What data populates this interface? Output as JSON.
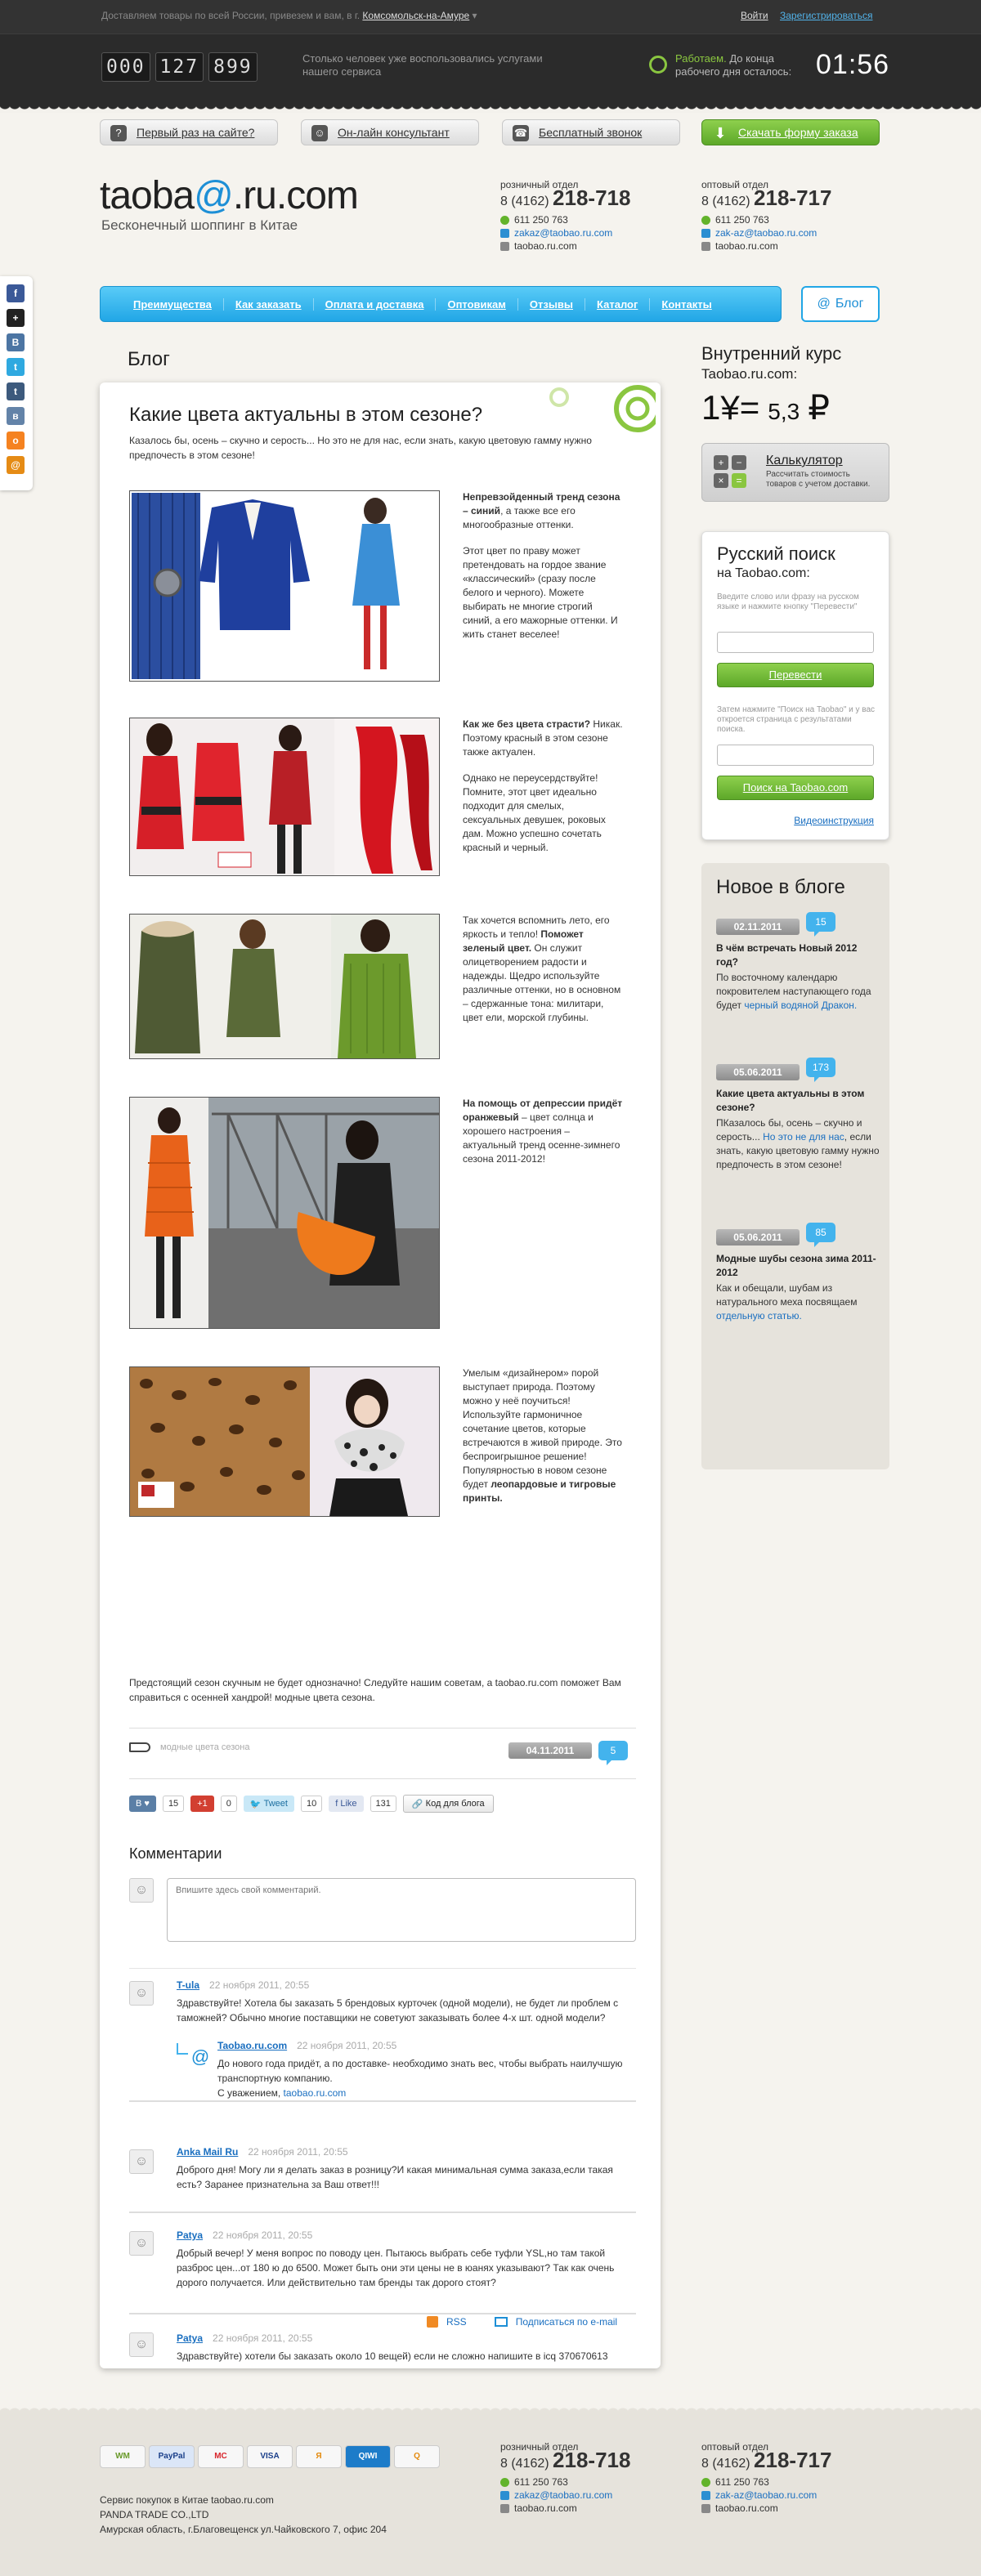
{
  "topbar": {
    "delivery_text": "Доставляем товары по всей России, привезем и вам, в г.",
    "city": "Комсомольск-на-Амуре",
    "login": "Войти",
    "register": "Зарегистрироваться",
    "counter": [
      "000",
      "127",
      "899"
    ],
    "counter_text": "Столько человек уже воспользовались услугами нашего сервиса",
    "work_status": "Работаем.",
    "work_text": "До конца рабочего дня осталось:",
    "time_left": "01:56"
  },
  "actions": {
    "first_time": "Первый раз на сайте?",
    "consultant": "Он-лайн консультант",
    "free_call": "Бесплатный звонок",
    "download": "Скачать форму заказа"
  },
  "brand": {
    "logo_pre": "taoba",
    "logo_swirl": "@",
    "logo_post": ".ru.com",
    "slogan": "Бесконечный шоппинг в Китае"
  },
  "contacts": [
    {
      "title": "розничный отдел",
      "code": "8 (4162)",
      "number": "218-718",
      "icq": "611 250 763",
      "email": "zakaz@taobao.ru.com",
      "site": "taobao.ru.com"
    },
    {
      "title": "оптовый отдел",
      "code": "8 (4162)",
      "number": "218-717",
      "icq": "611 250 763",
      "email": "zak-az@taobao.ru.com",
      "site": "taobao.ru.com"
    }
  ],
  "menu": [
    "Преимущества",
    "Как заказать",
    "Оплата и доставка",
    "Оптовикам",
    "Отзывы",
    "Каталог",
    "Контакты"
  ],
  "blog_button": "Блог",
  "section_title": "Блог",
  "article": {
    "title": "Какие цвета актуальны в этом сезоне?",
    "intro": "Казалось бы, осень – скучно и серость... Но это не для нас, если знать, какую цветовую гамму нужно предпочесть в этом сезоне!",
    "blocks": [
      {
        "p1_bold": "Непревзойденный тренд сезона – синий",
        "p1_rest": ", а также все его многообразные оттенки.",
        "p2": "Этот цвет по праву может претендовать на гордое звание «классический» (сразу после белого и черного). Можете выбирать не многие строгий синий, а его мажорные оттенки. И жить станет веселее!"
      },
      {
        "p1_bold": "Как же без цвета страсти?",
        "p1_rest": " Никак. Поэтому красный в этом сезоне также актуален.",
        "p2": "Однако не переусердствуйте! Помните, этот цвет идеально подходит для смелых, сексуальных девушек, роковых дам. Можно успешно сочетать красный и черный."
      },
      {
        "p1_pre": "Так хочется вспомнить лето, его яркость и тепло! ",
        "p1_bold": "Поможет зеленый цвет.",
        "p1_rest": " Он служит олицетворением радости и надежды. Щедро используйте различные оттенки, но в основном – сдержанные тона: милитари, цвет ели, морской глубины."
      },
      {
        "p1_bold": "На помощь от депрессии придёт оранжевый",
        "p1_rest": " – цвет солнца и хорошего настроения – актуальный тренд осенне-зимнего сезона 2011-2012!"
      },
      {
        "p1_pre": "Умелым «дизайнером» порой выступает природа. Поэтому можно у неё поучиться! Используйте гармоничное сочетание цветов, которые встречаются в живой природе. Это беспроигрышное решение! Популярностью в новом сезоне будет ",
        "p1_bold": "леопардовые и тигровые принты."
      }
    ],
    "summary": "Предстоящий сезон скучным не будет однозначно! Следуйте нашим советам, а taobao.ru.com поможет Вам справиться с осенней хандрой! модные цвета сезона.",
    "tag": "модные цвета сезона",
    "date": "04.11.2011",
    "comments_count": "5",
    "share": {
      "vk_count": "15",
      "gplus_count": "0",
      "tweet": "Tweet",
      "tweet_count": "10",
      "like": "Like",
      "like_count": "131",
      "code_button": "Код для блога"
    }
  },
  "comments": {
    "heading": "Комментарии",
    "placeholder": "Впишите здесь свой комментарий.",
    "items": [
      {
        "author": "T-ula",
        "date": "22 ноября 2011, 20:55",
        "text": "Здравствуйте! Хотела бы заказать 5 брендовых курточек (одной модели), не будет ли проблем с таможней? Обычно многие поставщики не советуют заказывать более 4-х шт. одной модели?"
      },
      {
        "author": "Taobao.ru.com",
        "date": "22 ноября 2011, 20:55",
        "text": "До нового года придёт, а по доставке- необходимо знать вес, чтобы выбрать наилучшую транспортную компанию.",
        "sign": "С уважением,",
        "sign_link": "taobao.ru.com"
      },
      {
        "author": "Anka Mail Ru",
        "date": "22 ноября 2011, 20:55",
        "text": "Доброго дня! Могу ли я делать заказ в розницу?И какая минимальная сумма заказа,если такая есть? Заранее признательна за Ваш ответ!!!"
      },
      {
        "author": "Patya",
        "date": "22 ноября 2011, 20:55",
        "text": "Добрый вечер! У меня вопрос по поводу цен. Пытаюсь выбрать себе туфли YSL,но там такой разброс цен...от 180 ю до 6500. Может быть они эти цены не в юанях указывают? Так как очень дорого получается. Или действительно там бренды так дорого стоят?"
      },
      {
        "author": "Patya",
        "date": "22 ноября 2011, 20:55",
        "text": "Здравствуйте) хотели бы заказать около 10 вещей) если не сложно напишите в icq 370670613"
      }
    ],
    "rss": "RSS",
    "subscribe": "Подписаться по e-mail"
  },
  "sidebar": {
    "rate_title": "Внутренний курс",
    "rate_sub": "Taobao.ru.com:",
    "rate_left": "1¥",
    "rate_eq": "=",
    "rate_value": "5,3",
    "rate_currency": "₽",
    "calc_title": "Калькулятор",
    "calc_sub": "Рассчитать стоимость товаров с учетом доставки.",
    "search_title": "Русский поиск",
    "search_sub": "на Taobao.com:",
    "search_hint": "Введите слово или фразу на русском языке и нажмите кнопку \"Перевести\"",
    "translate_btn": "Перевести",
    "search_hint2": "Затем нажмите \"Поиск на Taobao\" и у вас откроется страница с результатами поиска.",
    "search_btn": "Поиск на Taobao.com",
    "video_link": "Видеоинструкция",
    "news_title": "Новое в блоге",
    "news": [
      {
        "date": "02.11.2011",
        "count": "15",
        "title": "В чём встречать Новый 2012 год?",
        "text": "По восточному календарю покровителем наступающего года будет ",
        "link": "черный водяной Дракон."
      },
      {
        "date": "05.06.2011",
        "count": "173",
        "title": "Какие цвета актуальны в этом сезоне?",
        "text_pre": "ПКазалось бы, осень – скучно и серость... ",
        "link": "Но это не для нас",
        "text": ", если знать, какую цветовую гамму нужно предпочесть в этом сезоне!"
      },
      {
        "date": "05.06.2011",
        "count": "85",
        "title": "Модные шубы сезона зима 2011-2012",
        "text": "Как и обещали, шубам из натурального меха посвящаем ",
        "link": "отдельную статью."
      }
    ]
  },
  "footer": {
    "payments": [
      "WM",
      "PayPal",
      "MC",
      "VISA",
      "Я",
      "QIWI",
      "Q"
    ],
    "line1": "Сервис покупок в Китае taobao.ru.com",
    "line2": "PANDA TRADE CO.,LTD",
    "line3": "Амурская область, г.Благовещенск ул.Чайковского 7, офис 204"
  },
  "colors": {
    "accent_blue": "#21a6e6",
    "accent_green": "#5da829",
    "dark_bar": "#2b2b2b"
  },
  "icons": [
    "clock-icon",
    "question-icon",
    "consultant-icon",
    "phone-icon",
    "download-icon",
    "swirl-logo-icon",
    "rss-icon",
    "mail-icon"
  ]
}
